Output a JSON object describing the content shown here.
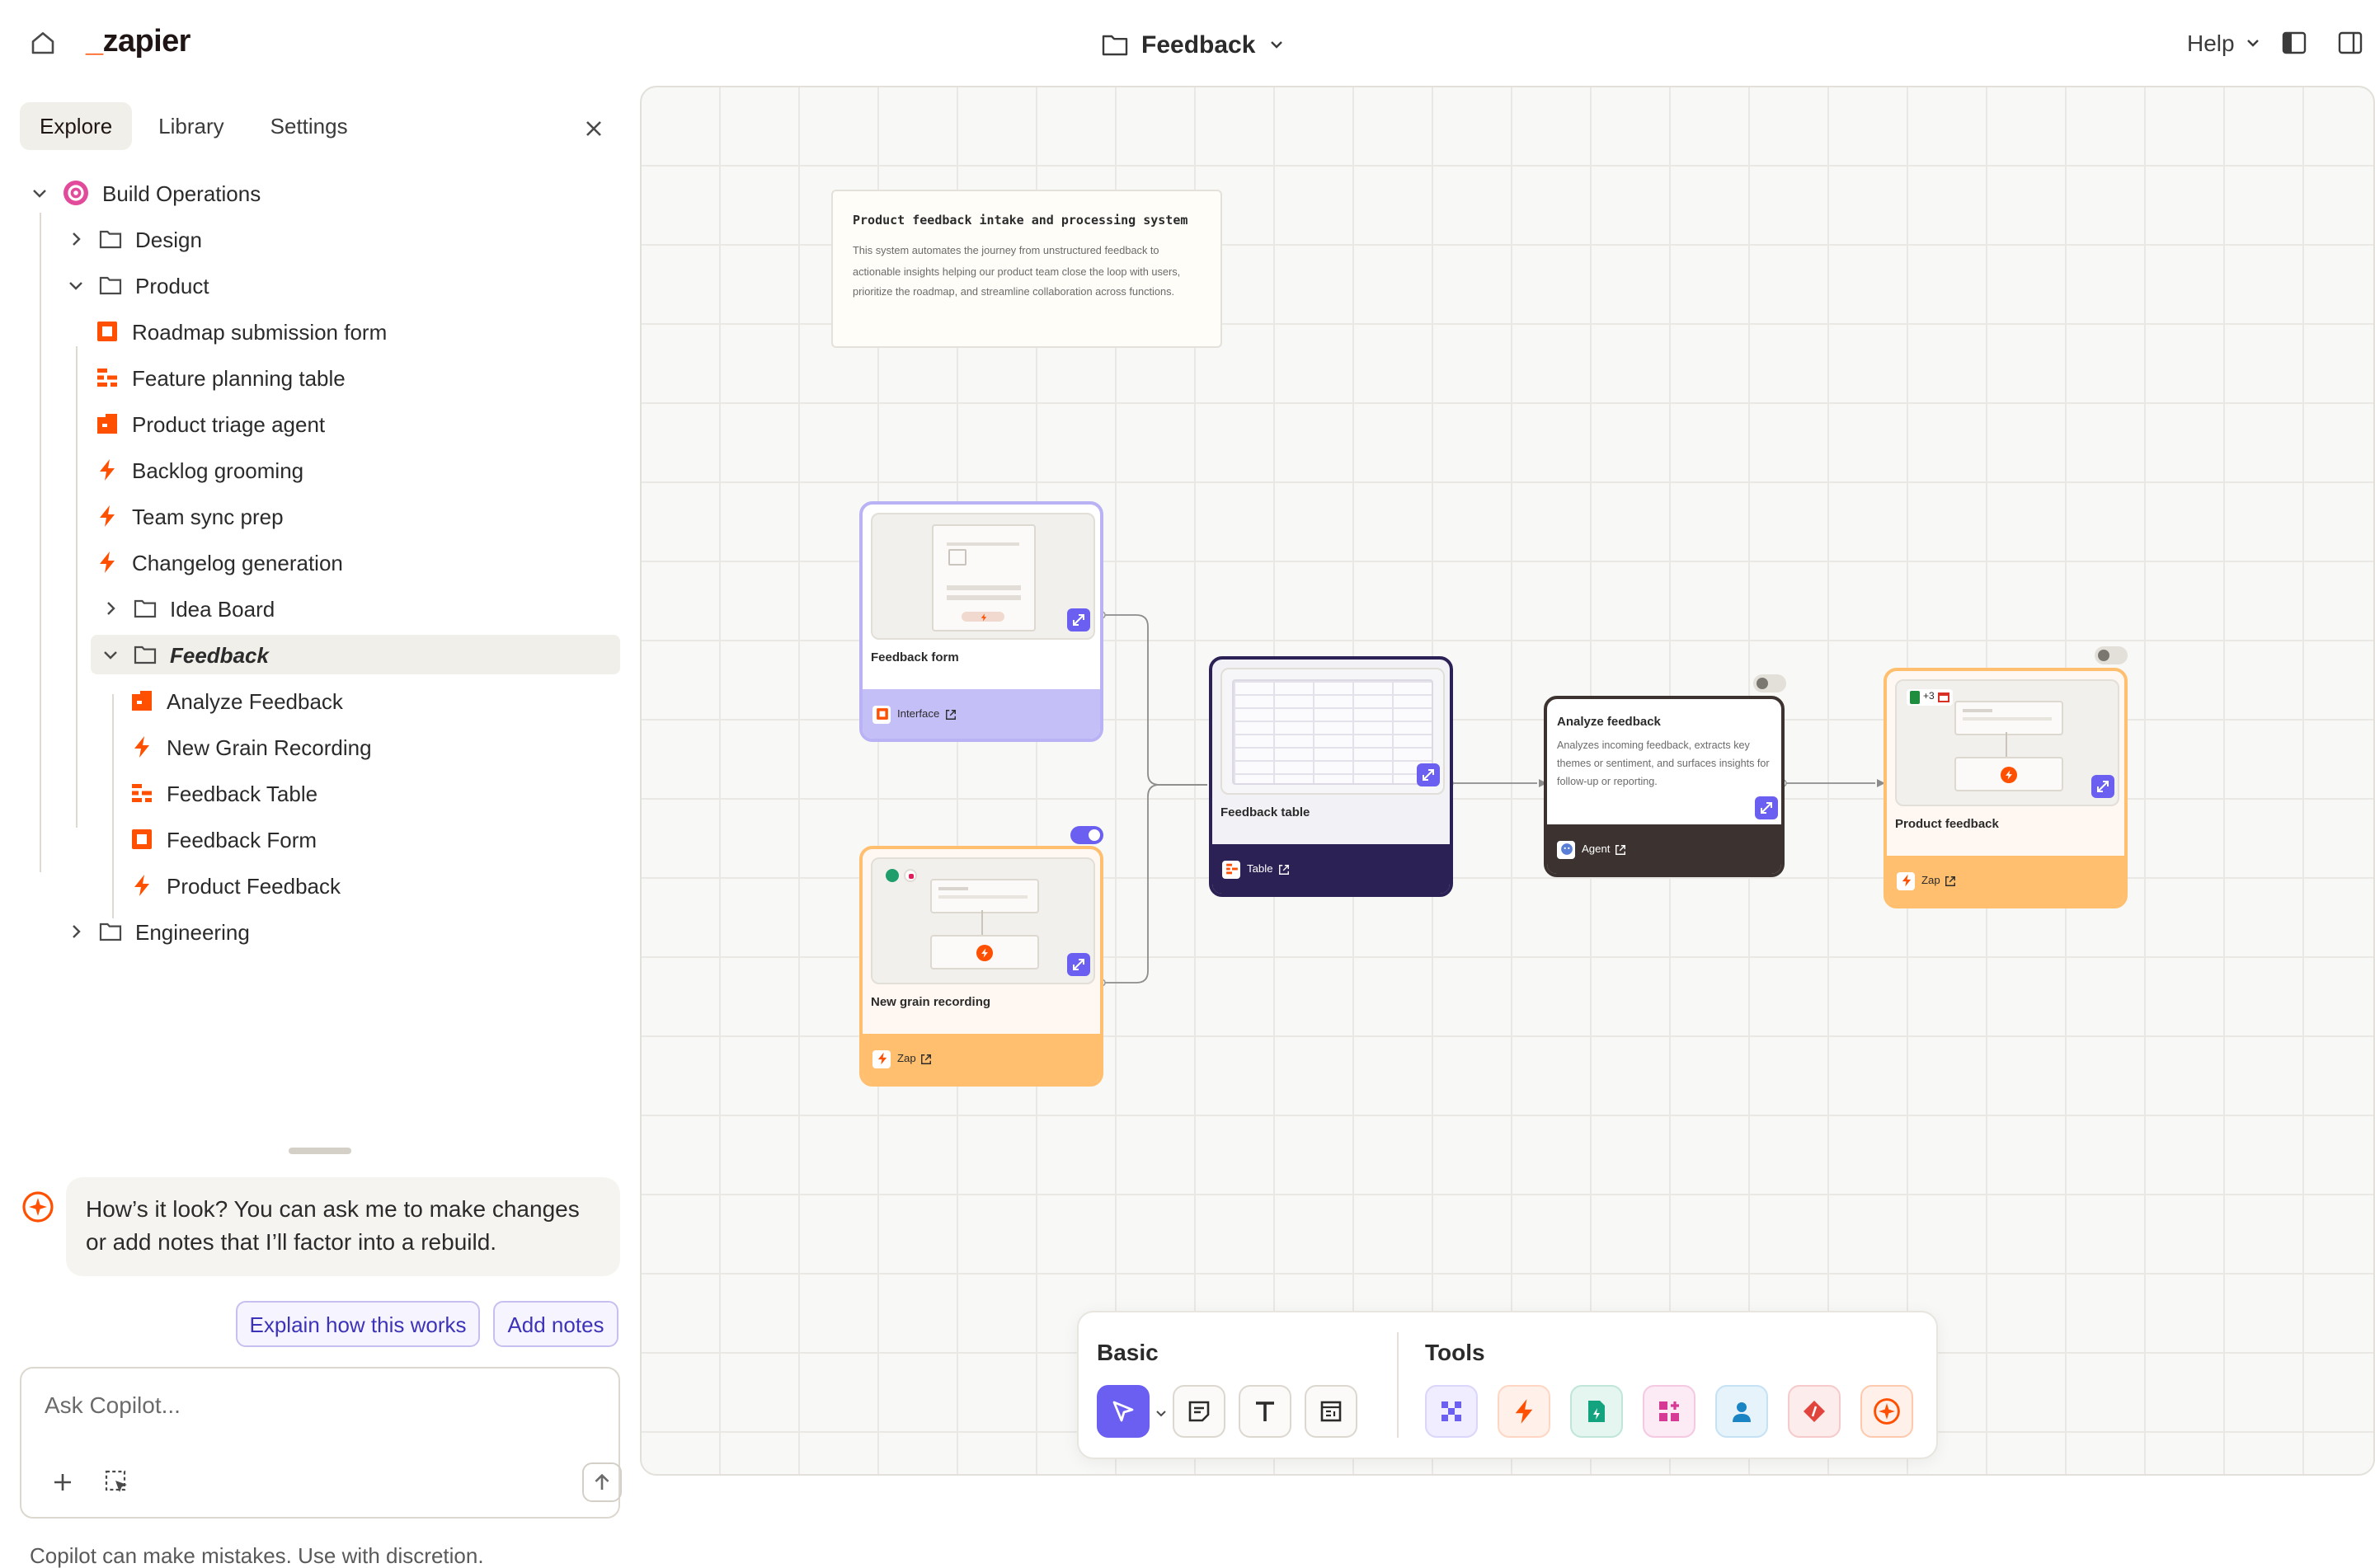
{
  "header": {
    "logo_text": "zapier",
    "title": "Feedback",
    "help_label": "Help"
  },
  "sidebar": {
    "tabs": [
      "Explore",
      "Library",
      "Settings"
    ],
    "active_tab": "Explore",
    "tree": [
      {
        "label": "Build Operations",
        "type": "workspace",
        "expanded": true
      },
      {
        "label": "Design",
        "type": "folder",
        "expanded": false
      },
      {
        "label": "Product",
        "type": "folder",
        "expanded": true
      },
      {
        "label": "Roadmap submission form",
        "type": "interface"
      },
      {
        "label": "Feature planning table",
        "type": "table"
      },
      {
        "label": "Product triage agent",
        "type": "agent"
      },
      {
        "label": "Backlog grooming",
        "type": "zap"
      },
      {
        "label": "Team sync prep",
        "type": "zap"
      },
      {
        "label": "Changelog generation",
        "type": "zap"
      },
      {
        "label": "Idea Board",
        "type": "folder",
        "expanded": false
      },
      {
        "label": "Feedback",
        "type": "folder",
        "expanded": true,
        "selected": true
      },
      {
        "label": "Analyze Feedback",
        "type": "agent"
      },
      {
        "label": "New Grain Recording",
        "type": "zap"
      },
      {
        "label": "Feedback Table",
        "type": "table"
      },
      {
        "label": "Feedback Form",
        "type": "interface"
      },
      {
        "label": "Product Feedback",
        "type": "zap"
      },
      {
        "label": "Engineering",
        "type": "folder",
        "expanded": false
      }
    ]
  },
  "copilot": {
    "message": "How’s it look? You can ask me to make changes or add notes that I’ll factor into a rebuild.",
    "suggestions": [
      "Explain how this works",
      "Add notes"
    ],
    "input_placeholder": "Ask Copilot...",
    "disclaimer": "Copilot can make mistakes. Use with discretion."
  },
  "canvas": {
    "note": {
      "title": "Product feedback intake and processing system",
      "body": "This system automates the journey from unstructured feedback to actionable insights helping our product team close the loop with users, prioritize the roadmap, and streamline collaboration across functions."
    },
    "nodes": {
      "feedback_form": {
        "name": "Feedback form",
        "kind": "Interface"
      },
      "new_grain": {
        "name": "New grain recording",
        "kind": "Zap",
        "enabled": true
      },
      "feedback_table": {
        "name": "Feedback table",
        "kind": "Table"
      },
      "analyze": {
        "name": "Analyze feedback",
        "description": "Analyzes incoming feedback, extracts key themes or sentiment, and surfaces insights for follow-up or reporting.",
        "kind": "Agent",
        "enabled": false
      },
      "product_feedback": {
        "name": "Product feedback",
        "kind": "Zap",
        "enabled": false,
        "extra_apps": "+3"
      }
    }
  },
  "toolbar": {
    "basic_label": "Basic",
    "tools_label": "Tools",
    "basic_tools": [
      "select-tool",
      "sticky-note-tool",
      "text-tool",
      "frame-tool"
    ],
    "tools": [
      "zapier-tool",
      "zap-tool",
      "form-tool",
      "interfaces-tool",
      "agent-tool",
      "webhook-tool",
      "copilot-tool"
    ]
  },
  "colors": {
    "brand_orange": "#ff4f00",
    "accent_purple": "#6a5ff0",
    "interface_footer": "#c5bff8",
    "zap_footer": "#ffbf6e",
    "table_footer": "#2b2154",
    "agent_footer": "#3c3330"
  }
}
